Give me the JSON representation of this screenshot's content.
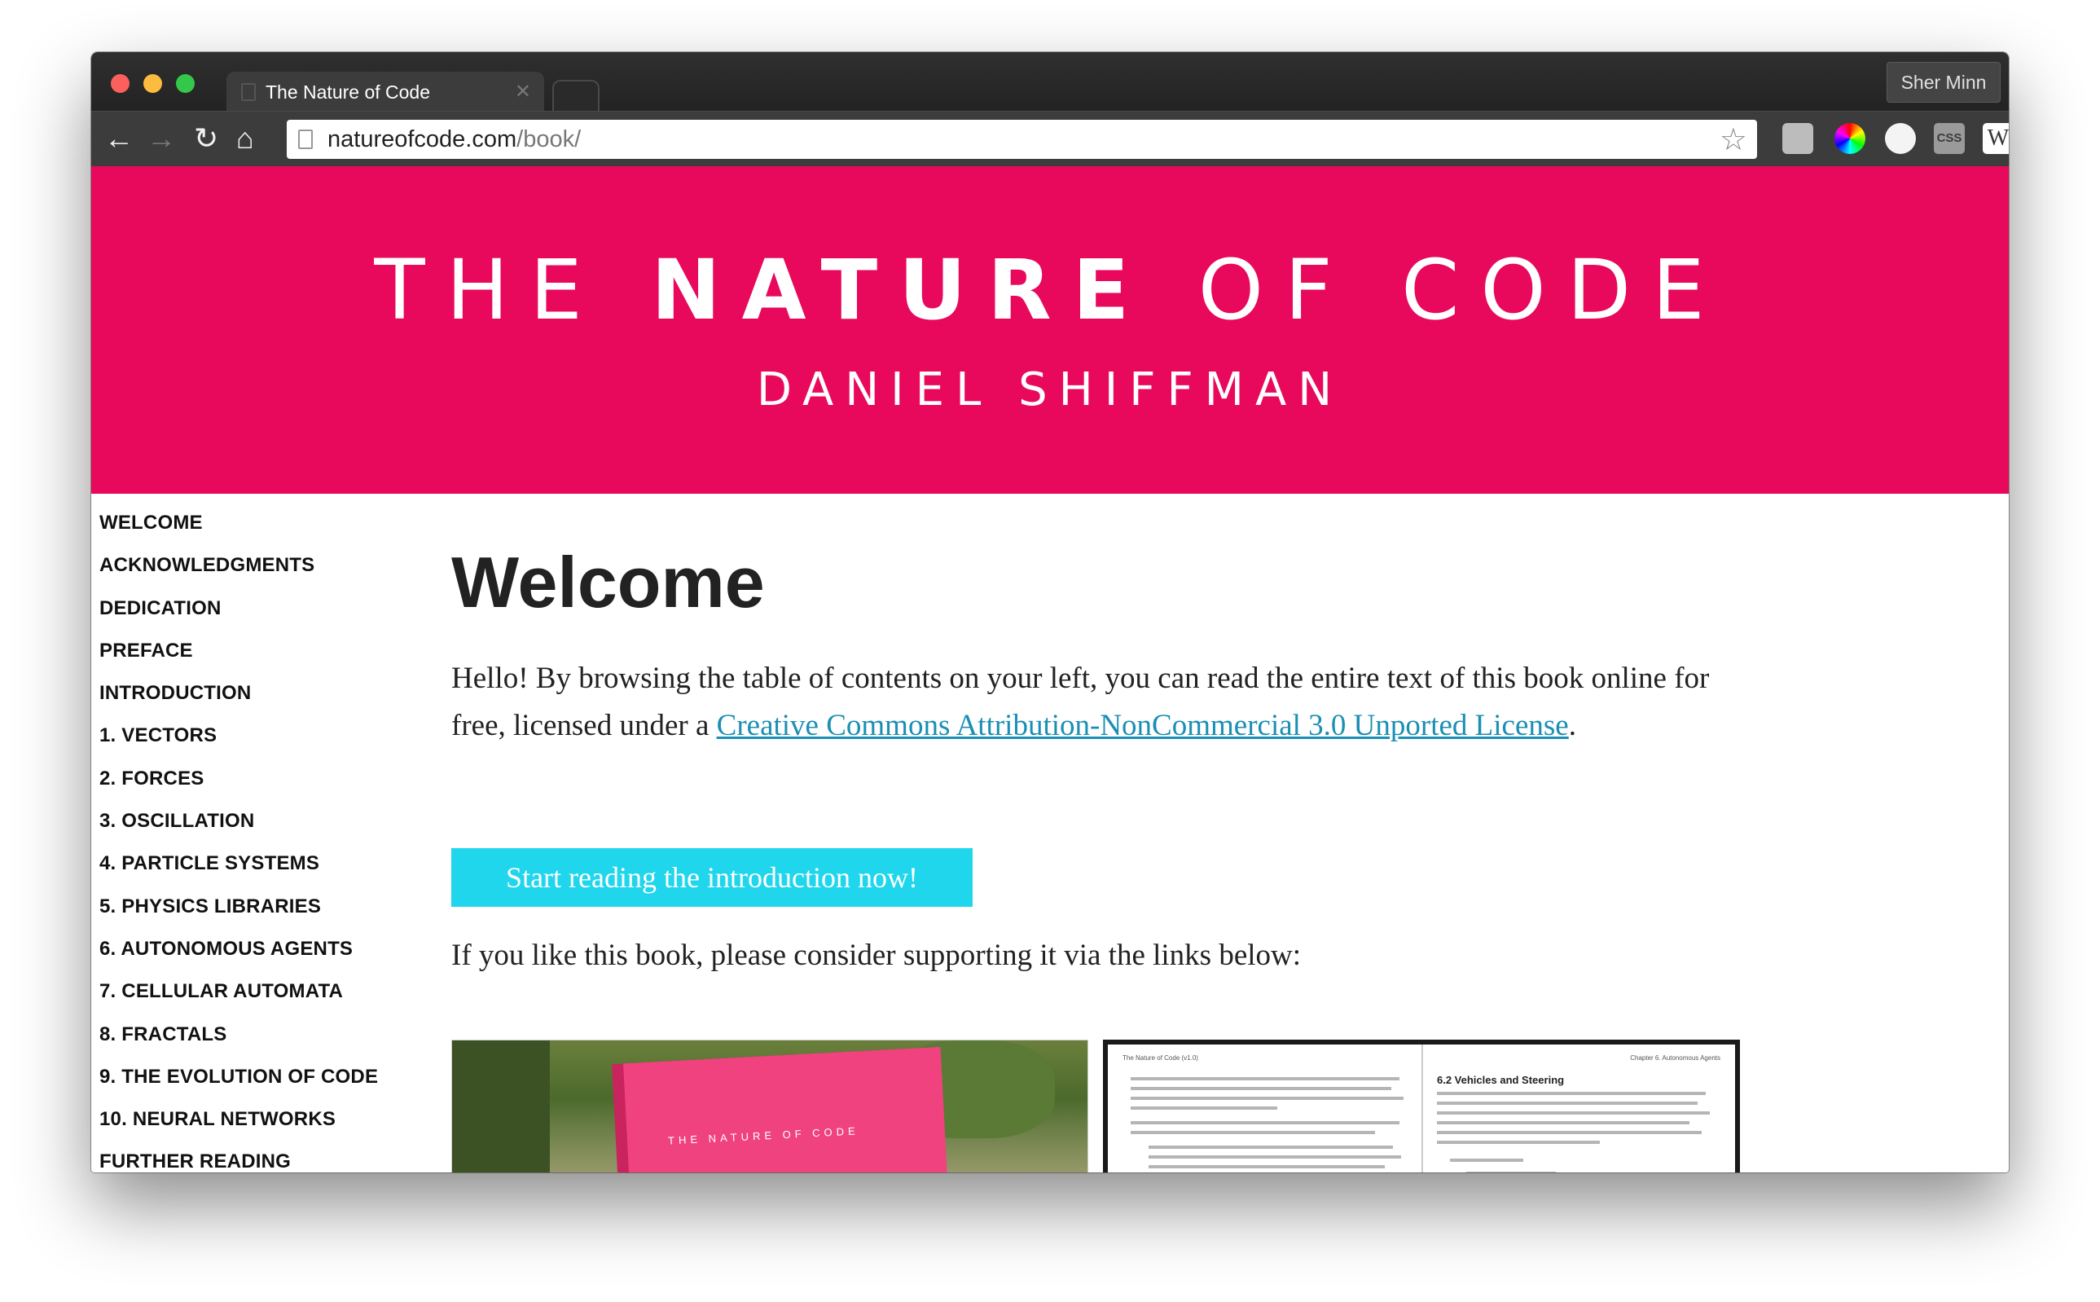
{
  "browser": {
    "tab_title": "The Nature of Code",
    "tab_close": "✕",
    "profile_name": "Sher Minn",
    "url_domain": "natureofcode.com",
    "url_path": "/book/",
    "icons": {
      "back": "←",
      "forward": "→",
      "reload": "↻",
      "home": "⌂",
      "bookmark": "☆",
      "css": "CSS",
      "wikipedia": "W",
      "fire": "🔥"
    }
  },
  "banner": {
    "title_before": "THE ",
    "title_bold": "NATURE",
    "title_after": " OF CODE",
    "author": "DANIEL SHIFFMAN",
    "color": "#e8085c"
  },
  "sidebar": {
    "items": [
      "WELCOME",
      "ACKNOWLEDGMENTS",
      "DEDICATION",
      "PREFACE",
      "INTRODUCTION",
      "1. VECTORS",
      "2. FORCES",
      "3. OSCILLATION",
      "4. PARTICLE SYSTEMS",
      "5. PHYSICS LIBRARIES",
      "6. AUTONOMOUS AGENTS",
      "7. CELLULAR AUTOMATA",
      "8. FRACTALS",
      "9. THE EVOLUTION OF CODE",
      "10. NEURAL NETWORKS",
      "FURTHER READING"
    ]
  },
  "main": {
    "heading": "Welcome",
    "intro_text": "Hello! By browsing the table of contents on your left, you can read the entire text of this book online for free, licensed under a ",
    "license_link": "Creative Commons Attribution-NonCommercial 3.0 Unported License",
    "intro_end": ".",
    "cta_label": "Start reading the introduction now!",
    "cta_color": "#1fd6ed",
    "support_text": "If you like this book, please consider supporting it via the links below:",
    "box_text": "THE NATURE OF CODE",
    "spread_left_head": "The Nature of Code (v1.0)",
    "spread_right_head": "Chapter 6. Autonomous Agents",
    "spread_subheading": "6.2 Vehicles and Steering"
  },
  "link_color": "#1a8fb4"
}
